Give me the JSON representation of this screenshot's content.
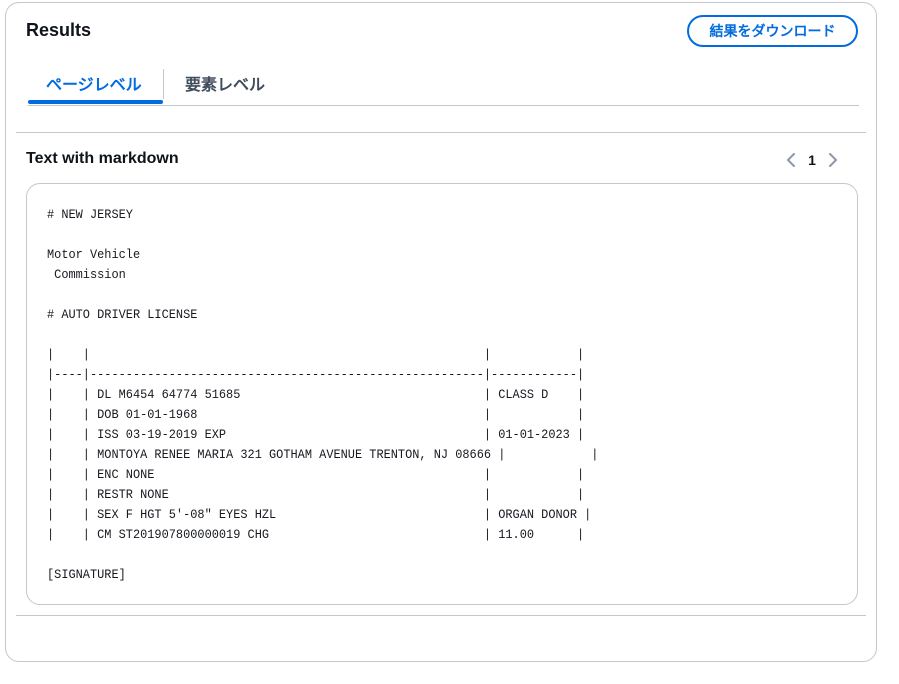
{
  "results": {
    "title": "Results",
    "download_label": "結果をダウンロード"
  },
  "tabs": [
    {
      "label": "ページレベル",
      "selected": true
    },
    {
      "label": "要素レベル",
      "selected": false
    }
  ],
  "section": {
    "title": "Text with markdown",
    "pager": {
      "current_page": "1"
    }
  },
  "markdown_text": "# NEW JERSEY\n\nMotor Vehicle\n Commission\n\n# AUTO DRIVER LICENSE\n\n|    |                                                       |            |\n|----|-------------------------------------------------------|------------|\n|    | DL M6454 64774 51685                                  | CLASS D    |\n|    | DOB 01-01-1968                                        |            |\n|    | ISS 03-19-2019 EXP                                    | 01-01-2023 |\n|    | MONTOYA RENEE MARIA 321 GOTHAM AVENUE TRENTON, NJ 08666 |            |\n|    | ENC NONE                                              |            |\n|    | RESTR NONE                                            |            |\n|    | SEX F HGT 5'-08\" EYES HZL                             | ORGAN DONOR |\n|    | CM ST201907800000019 CHG                              | 11.00      |\n\n[SIGNATURE]",
  "colors": {
    "accent": "#006ce0",
    "border": "#c6c6cd",
    "text": "#16191f",
    "muted": "#8d99a8"
  },
  "icons": {
    "prev": "chevron-left-icon",
    "next": "chevron-right-icon"
  }
}
